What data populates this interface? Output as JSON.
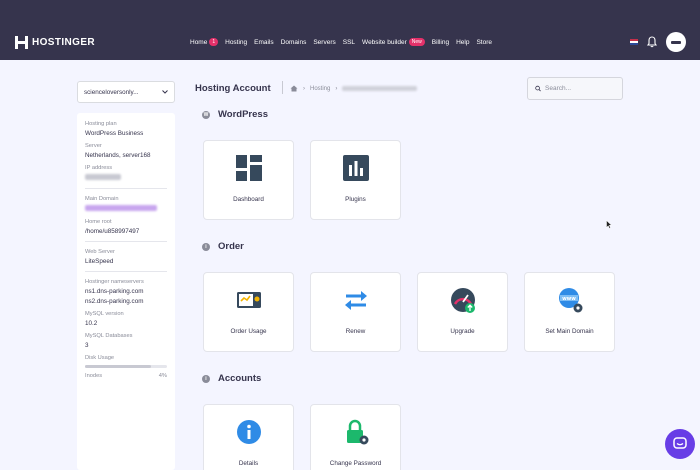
{
  "brand": {
    "name": "HOSTINGER"
  },
  "nav": {
    "items": [
      {
        "label": "Home",
        "badge": "1"
      },
      {
        "label": "Hosting"
      },
      {
        "label": "Emails"
      },
      {
        "label": "Domains"
      },
      {
        "label": "Servers"
      },
      {
        "label": "SSL"
      },
      {
        "label": "Website builder",
        "badge": "New"
      },
      {
        "label": "Billing"
      },
      {
        "label": "Help"
      },
      {
        "label": "Store"
      }
    ]
  },
  "site_selector": {
    "value": "scienceloversonly..."
  },
  "sidebar": {
    "hosting_plan_label": "Hosting plan",
    "hosting_plan_value": "WordPress Business",
    "server_label": "Server",
    "server_value": "Netherlands, server168",
    "ip_label": "IP address",
    "main_domain_label": "Main Domain",
    "home_root_label": "Home root",
    "home_root_value": "/home/u858997497",
    "web_server_label": "Web Server",
    "web_server_value": "LiteSpeed",
    "nameservers_label": "Hostinger nameservers",
    "ns1": "ns1.dns-parking.com",
    "ns2": "ns2.dns-parking.com",
    "mysql_version_label": "MySQL version",
    "mysql_version_value": "10.2",
    "mysql_db_label": "MySQL Databases",
    "mysql_db_value": "3",
    "disk_usage_label": "Disk Usage",
    "disk_usage_fraction": 0.8,
    "inodes_label": "Inodes",
    "inodes_value": "4%"
  },
  "header": {
    "title": "Hosting Account",
    "breadcrumb_hosting": "Hosting",
    "search_placeholder": "Search..."
  },
  "sections": {
    "wordpress": {
      "title": "WordPress",
      "cards": [
        "Dashboard",
        "Plugins"
      ]
    },
    "order": {
      "title": "Order",
      "cards": [
        "Order Usage",
        "Renew",
        "Upgrade",
        "Set Main Domain"
      ]
    },
    "accounts": {
      "title": "Accounts",
      "cards": [
        "Details",
        "Change Password"
      ]
    }
  },
  "icons": {
    "section_wordpress": "wordpress-icon",
    "section_order": "info-icon",
    "section_accounts": "info-icon"
  },
  "colors": {
    "topbar": "#36344d",
    "accent": "#673de6",
    "badge": "#e4316a",
    "blue": "#2f8be6",
    "green": "#1cb86c"
  }
}
